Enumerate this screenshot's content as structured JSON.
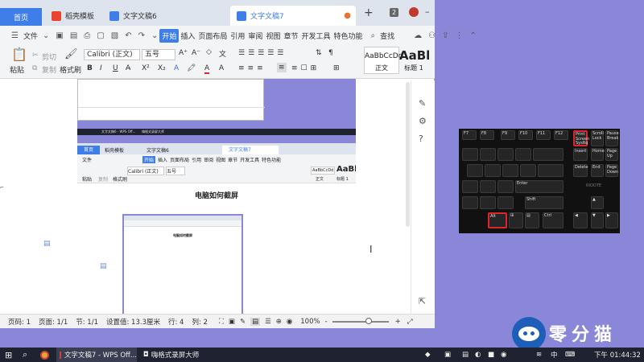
{
  "tabs": {
    "home": "首页",
    "t1": "稻壳模板",
    "t2": "文字文稿6",
    "t3": "文字文稿7",
    "badge": "2"
  },
  "menu": {
    "file": "文件",
    "items": [
      "开始",
      "插入",
      "页面布局",
      "引用",
      "审阅",
      "视图",
      "章节",
      "开发工具",
      "特色功能"
    ],
    "search": "查找"
  },
  "ribbon": {
    "paste": "粘贴",
    "cut": "剪切",
    "copy": "复制",
    "format_painter": "格式刷",
    "font": "Calibri (正文)",
    "size": "五号",
    "style1_preview": "AaBbCcDd",
    "style1_name": "正文",
    "style2_preview": "AaBl",
    "style2_name": "标题 1"
  },
  "nested": {
    "tabs": [
      "首页",
      "稻壳模板",
      "文字文稿6",
      "文字文稿7"
    ],
    "menu": [
      "文件",
      "开始",
      "插入",
      "页面布局",
      "引用",
      "审阅",
      "视图",
      "章节",
      "开发工具",
      "特色功能"
    ],
    "font": "Calibri (正文)",
    "size": "五号",
    "paste": "粘贴",
    "copy": "复制",
    "painter": "格式刷",
    "style1": "AaBbCcDd",
    "style1_name": "正文",
    "style2": "AaBl",
    "style2_name": "标题 1",
    "heading": "电脑如何截屏",
    "heading_small": "电脑如何截屏",
    "taskbar_item1": "文字文稿6 - WPS Off...",
    "taskbar_item2": "嗨格式录屏大师"
  },
  "status": {
    "page_code": "页码: 1",
    "pages": "页面: 1/1",
    "section": "节: 1/1",
    "setting": "设置值: 13.3厘米",
    "row": "行: 4",
    "col": "列: 2",
    "zoom": "100%",
    "minus": "-",
    "plus": "+"
  },
  "keyboard": {
    "keys": [
      "F7",
      "F8",
      "F9",
      "F10",
      "F11",
      "F12",
      "Print Screen SysRq",
      "Scroll Lock",
      "Pause Break",
      "Insert",
      "Home",
      "Page Up",
      "Delete",
      "End",
      "Page Down",
      "Enter",
      "Shift",
      "Alt",
      "Ctrl"
    ],
    "brand": "RIOOTE"
  },
  "taskbar": {
    "app1": "文字文稿7 - WPS Off...",
    "app2": "嗨格式录屏大师",
    "ime": "中",
    "time": "下午 01:44:32"
  },
  "watermark": {
    "text": "零分猫"
  },
  "colors": {
    "accent": "#3f7ee8",
    "desktop": "#8a86d8",
    "highlight": "#e0242a"
  }
}
